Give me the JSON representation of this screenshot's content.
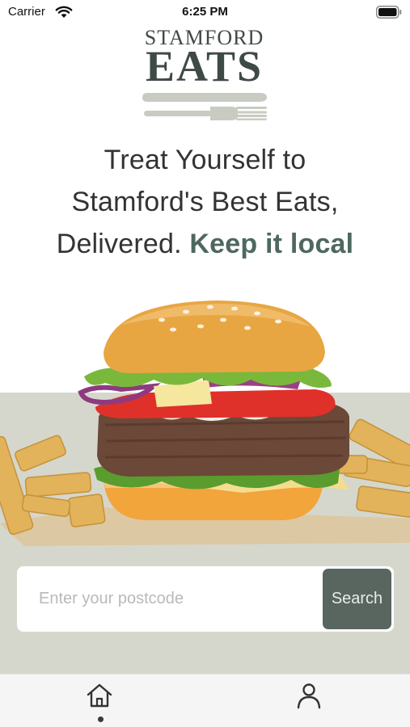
{
  "status_bar": {
    "carrier": "Carrier",
    "time": "6:25 PM",
    "wifi_icon": "wifi-icon",
    "battery_icon": "battery-icon"
  },
  "logo": {
    "line1": "STAMFORD",
    "line2": "EATS",
    "icon": "cutlery-icon"
  },
  "headline": {
    "line1": "Treat Yourself to",
    "line2": "Stamford's Best Eats,",
    "line3_plain": "Delivered.",
    "line3_accent": "Keep it local"
  },
  "hero": {
    "image": "burger-and-fries-photo"
  },
  "search": {
    "placeholder": "Enter your postcode",
    "value": "",
    "button_label": "Search"
  },
  "tab_bar": {
    "items": [
      {
        "icon": "home-icon",
        "selected": true
      },
      {
        "icon": "user-icon",
        "selected": false
      }
    ]
  },
  "colors": {
    "brand_dark": "#3f4a45",
    "accent": "#4e6860",
    "button": "#58665f",
    "hero_background": "#d5d7cd",
    "tab_bar_background": "#f5f5f5"
  }
}
